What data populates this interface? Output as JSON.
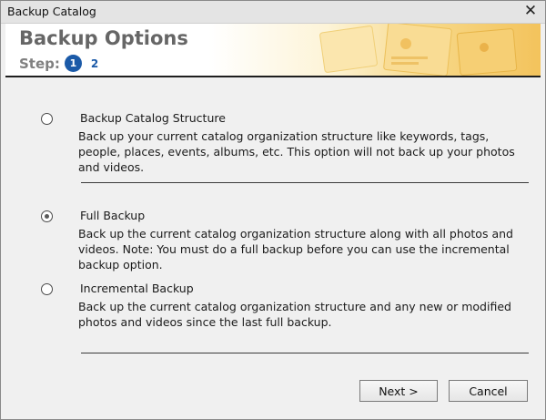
{
  "window": {
    "title": "Backup Catalog"
  },
  "header": {
    "title": "Backup Options",
    "step_label": "Step:",
    "step_current": "1",
    "step_next": "2"
  },
  "options": [
    {
      "label": "Backup Catalog Structure",
      "description": "Back up your current catalog organization structure like keywords, tags, people, places, events, albums, etc. This option will not back up your photos and videos.",
      "selected": false
    },
    {
      "label": "Full Backup",
      "description": "Back up the current catalog organization structure along with all photos and videos. Note: You must do a full backup before you can use the incremental backup option.",
      "selected": true
    },
    {
      "label": "Incremental Backup",
      "description": "Back up the current catalog organization structure and any new or modified photos and videos since the last full backup.",
      "selected": false
    }
  ],
  "buttons": {
    "next": "Next >",
    "cancel": "Cancel"
  },
  "colors": {
    "accent": "#1b5aa8",
    "banner_gold": "#f3c35c"
  }
}
